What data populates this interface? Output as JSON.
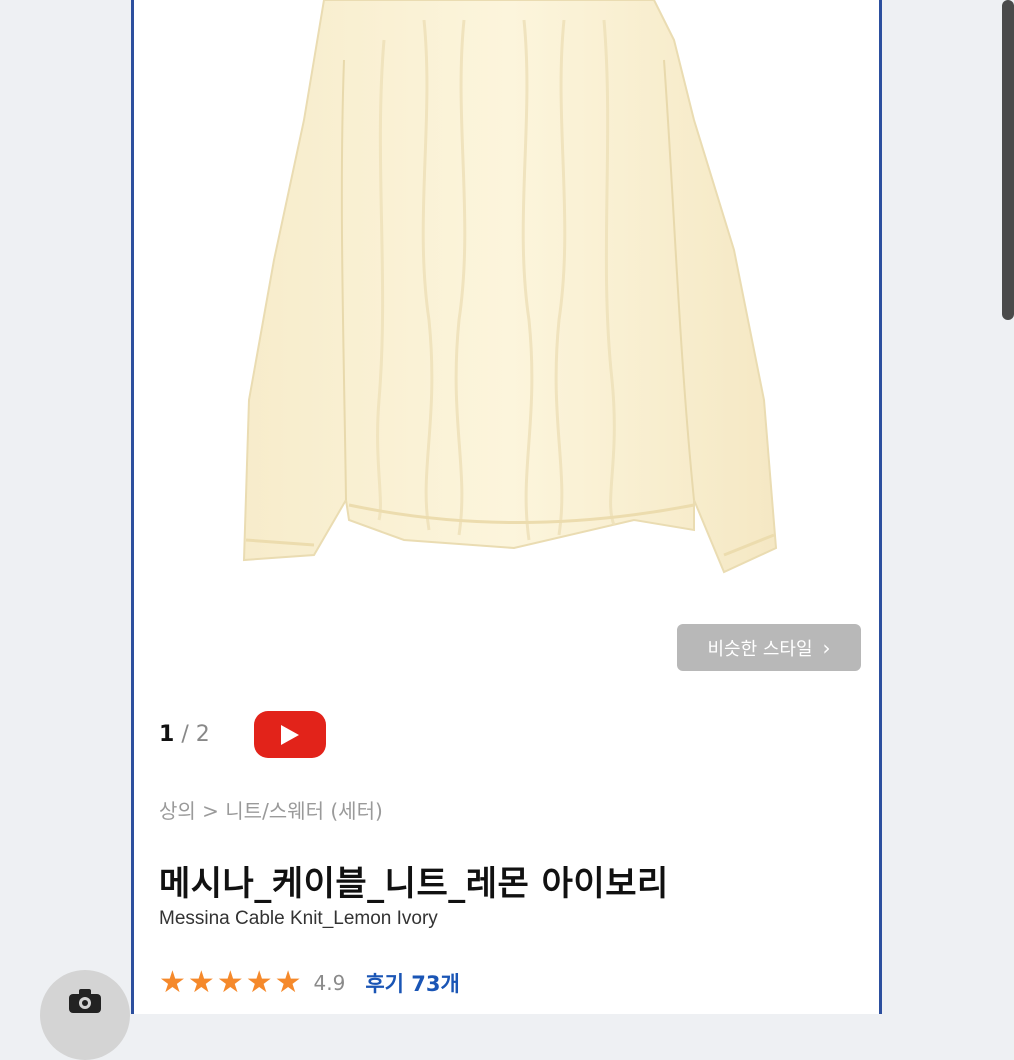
{
  "gallery": {
    "similar_style_label": "비슷한 스타일",
    "similar_style_icon": "chevron-right-icon",
    "current_page": "1",
    "page_separator": "/",
    "total_pages": "2",
    "video_icon": "youtube-play-icon"
  },
  "product": {
    "breadcrumb": "상의 > 니트/스웨터 (세터)",
    "title": "메시나_케이블_니트_레몬 아이보리",
    "subtitle": "Messina Cable Knit_Lemon Ivory",
    "rating": {
      "stars": 5,
      "score": "4.9",
      "reviews_label": "후기 73개"
    }
  },
  "overlay": {
    "camera_icon": "camera-icon"
  },
  "colors": {
    "accent_border": "#2c4f9e",
    "star": "#f5892b",
    "review_link": "#1a55b5",
    "youtube_red": "#e2231a",
    "sweater": "#fbf3d5"
  }
}
